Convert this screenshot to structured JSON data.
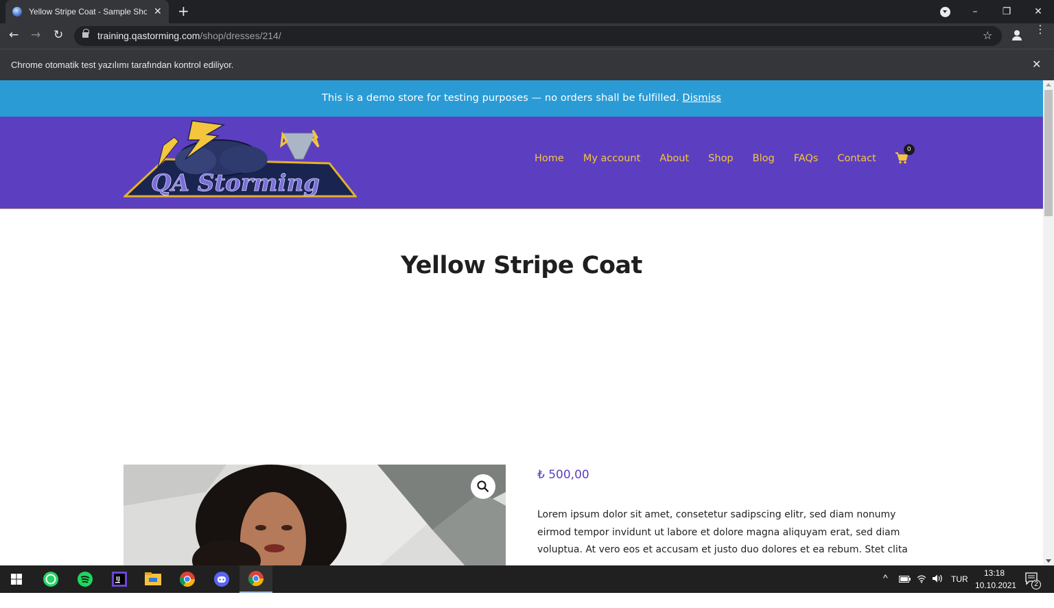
{
  "browser": {
    "tab_title": "Yellow Stripe Coat - Sample Shop",
    "new_tab": "+",
    "url_host": "training.qastorming.com",
    "url_path": "/shop/dresses/214/",
    "infobar_text": "Chrome otomatik test yazılımı tarafından kontrol ediliyor."
  },
  "demo_notice": {
    "text": "This is a demo store for testing purposes — no orders shall be fulfilled.",
    "dismiss": "Dismiss"
  },
  "header": {
    "logo_text": "QA Storming",
    "nav": [
      "Home",
      "My account",
      "About",
      "Shop",
      "Blog",
      "FAQs",
      "Contact"
    ],
    "cart_count": "0"
  },
  "product": {
    "title": "Yellow Stripe Coat",
    "price": "₺ 500,00",
    "description": "Lorem ipsum dolor sit amet, consetetur sadipscing elitr, sed diam nonumy eirmod tempor invidunt ut labore et dolore magna aliquyam erat, sed diam voluptua. At vero eos et accusam et justo duo dolores et ea rebum. Stet clita"
  },
  "taskbar": {
    "lang": "TUR",
    "time": "13:18",
    "date": "10.10.2021",
    "notifications": "2"
  },
  "colors": {
    "demo_bar": "#2a9bd5",
    "header": "#5c3fc1",
    "nav_link": "#f4c63d",
    "price": "#5c3fc1"
  }
}
